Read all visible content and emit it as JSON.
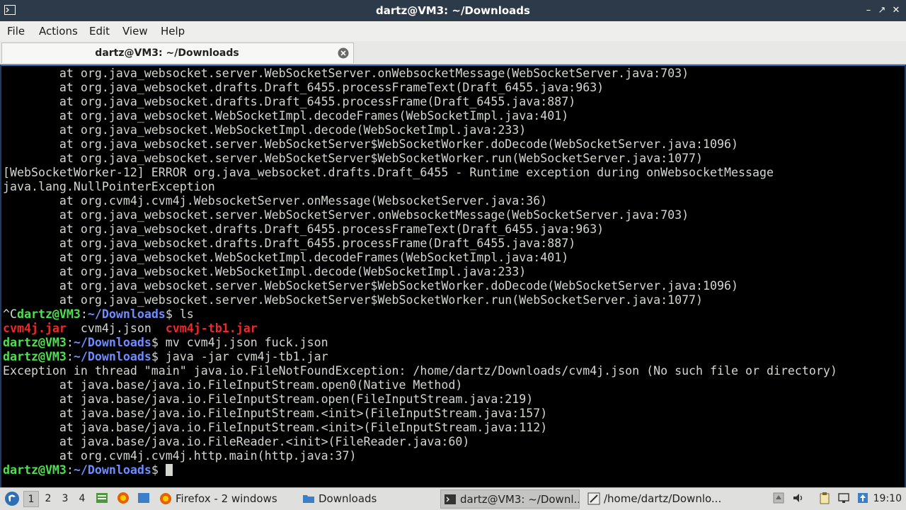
{
  "window": {
    "title": "dartz@VM3: ~/Downloads",
    "buttons": [
      "–",
      "↗",
      "✕"
    ]
  },
  "menu": [
    "File",
    "Actions",
    "Edit",
    "View",
    "Help"
  ],
  "tab": {
    "label": "dartz@VM3: ~/Downloads"
  },
  "terminal": {
    "lines": [
      [
        [
          "        at org.java_websocket.server.WebSocketServer.onWebsocketMessage(WebSocketServer.java:703)",
          ""
        ]
      ],
      [
        [
          "        at org.java_websocket.drafts.Draft_6455.processFrameText(Draft_6455.java:963)",
          ""
        ]
      ],
      [
        [
          "        at org.java_websocket.drafts.Draft_6455.processFrame(Draft_6455.java:887)",
          ""
        ]
      ],
      [
        [
          "        at org.java_websocket.WebSocketImpl.decodeFrames(WebSocketImpl.java:401)",
          ""
        ]
      ],
      [
        [
          "        at org.java_websocket.WebSocketImpl.decode(WebSocketImpl.java:233)",
          ""
        ]
      ],
      [
        [
          "        at org.java_websocket.server.WebSocketServer$WebSocketWorker.doDecode(WebSocketServer.java:1096)",
          ""
        ]
      ],
      [
        [
          "        at org.java_websocket.server.WebSocketServer$WebSocketWorker.run(WebSocketServer.java:1077)",
          ""
        ]
      ],
      [
        [
          "[WebSocketWorker-12] ERROR org.java_websocket.drafts.Draft_6455 - Runtime exception during onWebsocketMessage",
          ""
        ]
      ],
      [
        [
          "java.lang.NullPointerException",
          ""
        ]
      ],
      [
        [
          "        at org.cvm4j.cvm4j.WebsocketServer.onMessage(WebsocketServer.java:36)",
          ""
        ]
      ],
      [
        [
          "        at org.java_websocket.server.WebSocketServer.onWebsocketMessage(WebSocketServer.java:703)",
          ""
        ]
      ],
      [
        [
          "        at org.java_websocket.drafts.Draft_6455.processFrameText(Draft_6455.java:963)",
          ""
        ]
      ],
      [
        [
          "        at org.java_websocket.drafts.Draft_6455.processFrame(Draft_6455.java:887)",
          ""
        ]
      ],
      [
        [
          "        at org.java_websocket.WebSocketImpl.decodeFrames(WebSocketImpl.java:401)",
          ""
        ]
      ],
      [
        [
          "        at org.java_websocket.WebSocketImpl.decode(WebSocketImpl.java:233)",
          ""
        ]
      ],
      [
        [
          "        at org.java_websocket.server.WebSocketServer$WebSocketWorker.doDecode(WebSocketServer.java:1096)",
          ""
        ]
      ],
      [
        [
          "        at org.java_websocket.server.WebSocketServer$WebSocketWorker.run(WebSocketServer.java:1077)",
          ""
        ]
      ],
      [
        [
          "^C",
          ""
        ],
        [
          "dartz@VM3",
          "green"
        ],
        [
          ":",
          ""
        ],
        [
          "~/Downloads",
          "blue"
        ],
        [
          "$ ls",
          ""
        ]
      ],
      [
        [
          "cvm4j.jar",
          "red"
        ],
        [
          "  cvm4j.json  ",
          ""
        ],
        [
          "cvm4j-tb1.jar",
          "red"
        ]
      ],
      [
        [
          "dartz@VM3",
          "green"
        ],
        [
          ":",
          ""
        ],
        [
          "~/Downloads",
          "blue"
        ],
        [
          "$ mv cvm4j.json fuck.json",
          ""
        ]
      ],
      [
        [
          "dartz@VM3",
          "green"
        ],
        [
          ":",
          ""
        ],
        [
          "~/Downloads",
          "blue"
        ],
        [
          "$ java -jar cvm4j-tb1.jar",
          ""
        ]
      ],
      [
        [
          "Exception in thread \"main\" java.io.FileNotFoundException: /home/dartz/Downloads/cvm4j.json (No such file or directory)",
          ""
        ]
      ],
      [
        [
          "        at java.base/java.io.FileInputStream.open0(Native Method)",
          ""
        ]
      ],
      [
        [
          "        at java.base/java.io.FileInputStream.open(FileInputStream.java:219)",
          ""
        ]
      ],
      [
        [
          "        at java.base/java.io.FileInputStream.<init>(FileInputStream.java:157)",
          ""
        ]
      ],
      [
        [
          "        at java.base/java.io.FileInputStream.<init>(FileInputStream.java:112)",
          ""
        ]
      ],
      [
        [
          "        at java.base/java.io.FileReader.<init>(FileReader.java:60)",
          ""
        ]
      ],
      [
        [
          "        at org.cvm4j.cvm4j.http.main(http.java:37)",
          ""
        ]
      ],
      [
        [
          "dartz@VM3",
          "green"
        ],
        [
          ":",
          ""
        ],
        [
          "~/Downloads",
          "blue"
        ],
        [
          "$ ",
          ""
        ]
      ]
    ]
  },
  "taskbar": {
    "workspaces": [
      "1",
      "2",
      "3",
      "4"
    ],
    "active_workspace": "1",
    "tasks": [
      {
        "label": "Firefox - 2 windows",
        "icon": "firefox-icon"
      },
      {
        "label": "Downloads",
        "icon": "folder-icon"
      },
      {
        "label": "dartz@VM3: ~/Downl...",
        "icon": "terminal-icon"
      },
      {
        "label": "/home/dartz/Downlo...",
        "icon": "text-editor-icon"
      }
    ],
    "clock": "19:10"
  },
  "colors": {
    "titlebar": "#2d3a49",
    "prompt_user": "#4ee14e",
    "prompt_path": "#6f8dff",
    "jar_file": "#ef2929",
    "terminal_text": "#d3d7cf"
  }
}
